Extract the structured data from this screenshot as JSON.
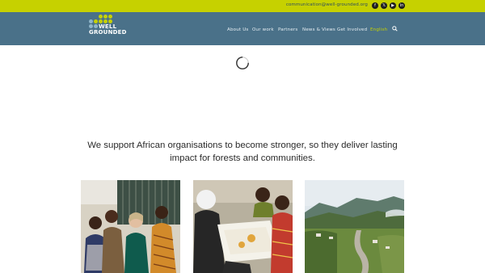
{
  "topbar": {
    "email": "communication@well-grounded.org",
    "social": [
      {
        "name": "facebook-icon",
        "glyph": "f"
      },
      {
        "name": "x-twitter-icon",
        "glyph": "𝕏"
      },
      {
        "name": "youtube-icon",
        "glyph": "▶"
      },
      {
        "name": "linkedin-icon",
        "glyph": "in"
      }
    ],
    "color": "#c6d100"
  },
  "header": {
    "logo_line1": "WELL",
    "logo_line2": "GROUNDED",
    "color": "#4a7189",
    "nav": [
      {
        "label": "About Us"
      },
      {
        "label": "Our work"
      },
      {
        "label": "Partners"
      },
      {
        "label": "News & Views"
      },
      {
        "label": "Get Involved"
      },
      {
        "label": "English",
        "active": true
      }
    ]
  },
  "main": {
    "tagline": "We support African organisations to become stronger, so they deliver lasting impact for forests and communities.",
    "photos": [
      {
        "name": "photo-group-of-women"
      },
      {
        "name": "photo-workshop-table"
      },
      {
        "name": "photo-forest-landscape"
      }
    ]
  }
}
